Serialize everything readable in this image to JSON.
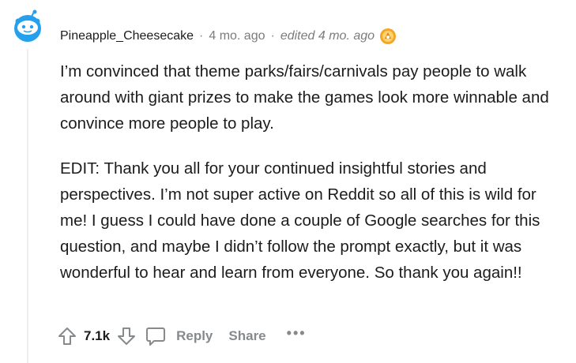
{
  "comment": {
    "username": "Pineapple_Cheesecake",
    "separator": "·",
    "time_ago": "4 mo. ago",
    "edited": "edited 4 mo. ago",
    "award_icon": "award-icon",
    "avatar_icon": "reddit-snoo-avatar",
    "paragraphs": [
      "I’m convinced that theme parks/fairs/carnivals pay people to walk around with giant prizes to make the games look more winnable and convince more people to play.",
      "EDIT: Thank you all for your continued insightful stories and perspectives. I’m not super active on Reddit so all of this is wild for me! I guess I could have done a couple of Google searches for this question, and maybe I didn’t follow the prompt exactly, but it was wonderful to hear and learn from everyone. So thank you again!!"
    ]
  },
  "actions": {
    "score": "7.1k",
    "reply_label": "Reply",
    "share_label": "Share",
    "more_label": "•••",
    "upvote_icon": "upvote-icon",
    "downvote_icon": "downvote-icon",
    "comment_icon": "comment-icon"
  },
  "colors": {
    "avatar_blue": "#24a0ed",
    "text": "#1c1c1c",
    "meta": "#7c7c7c",
    "action": "#878a8c",
    "thread_line": "#edeff1"
  }
}
